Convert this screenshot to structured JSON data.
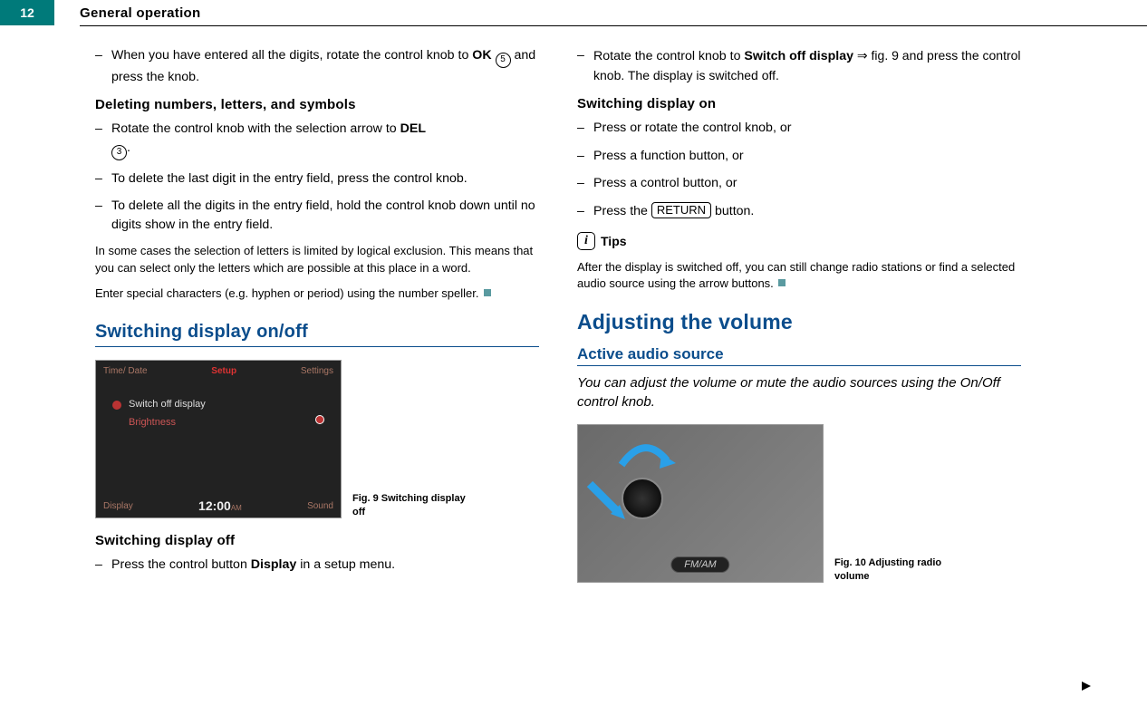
{
  "page_number": "12",
  "chapter_title": "General operation",
  "left": {
    "p1_a": "When you have entered all the digits, rotate the control knob to ",
    "p1_ok": "OK",
    "p1_num": "5",
    "p1_b": " and press the knob.",
    "h_del": "Deleting numbers, letters, and symbols",
    "p2_a": "Rotate the control knob with the selection arrow to ",
    "p2_del": "DEL",
    "p2_num": "3",
    "p2_b": ".",
    "p3": "To delete the last digit in the entry field, press the control knob.",
    "p4": "To delete all the digits in the entry field, hold the control knob down until no digits show in the entry field.",
    "note1": "In some cases the selection of letters is limited by logical exclusion. This means that you can select only the letters which are possible at this place in a word.",
    "note2": "Enter special characters (e.g. hyphen or period) using the number speller.",
    "h_switch": "Switching display on/off",
    "fig9_cap_a": "Fig. 9   Switching display off",
    "f9_top_left": "Time/ Date",
    "f9_top_mid": "Setup",
    "f9_top_right": "Settings",
    "f9_switch": "Switch off display",
    "f9_bright": "Brightness",
    "f9_display": "Display",
    "f9_time": "12:00",
    "f9_am": "AM",
    "f9_sound": "Sound",
    "h_switch_off": "Switching display off",
    "p5_a": "Press the control button ",
    "p5_b": "Display",
    "p5_c": " in a setup menu."
  },
  "right": {
    "p1_a": "Rotate the control knob to ",
    "p1_b": "Switch off display",
    "p1_c": " ⇒ fig. 9 and press the control knob. The display is switched off.",
    "h_on": "Switching display on",
    "p2": "Press or rotate the control knob, or",
    "p3": "Press a function button, or",
    "p4": "Press a control button, or",
    "p5_a": "Press the ",
    "p5_btn": "RETURN",
    "p5_b": " button.",
    "tips_label": "Tips",
    "tips_text": "After the display is switched off, you can still change radio stations or find a selected audio source using the arrow buttons.",
    "h1_vol": "Adjusting the volume",
    "h3_src": "Active audio source",
    "lead": "You can adjust the volume or mute the audio sources using the On/Off control knob.",
    "fig10_cap": "Fig. 10   Adjusting radio volume",
    "f10_fmam": "FM/AM"
  }
}
